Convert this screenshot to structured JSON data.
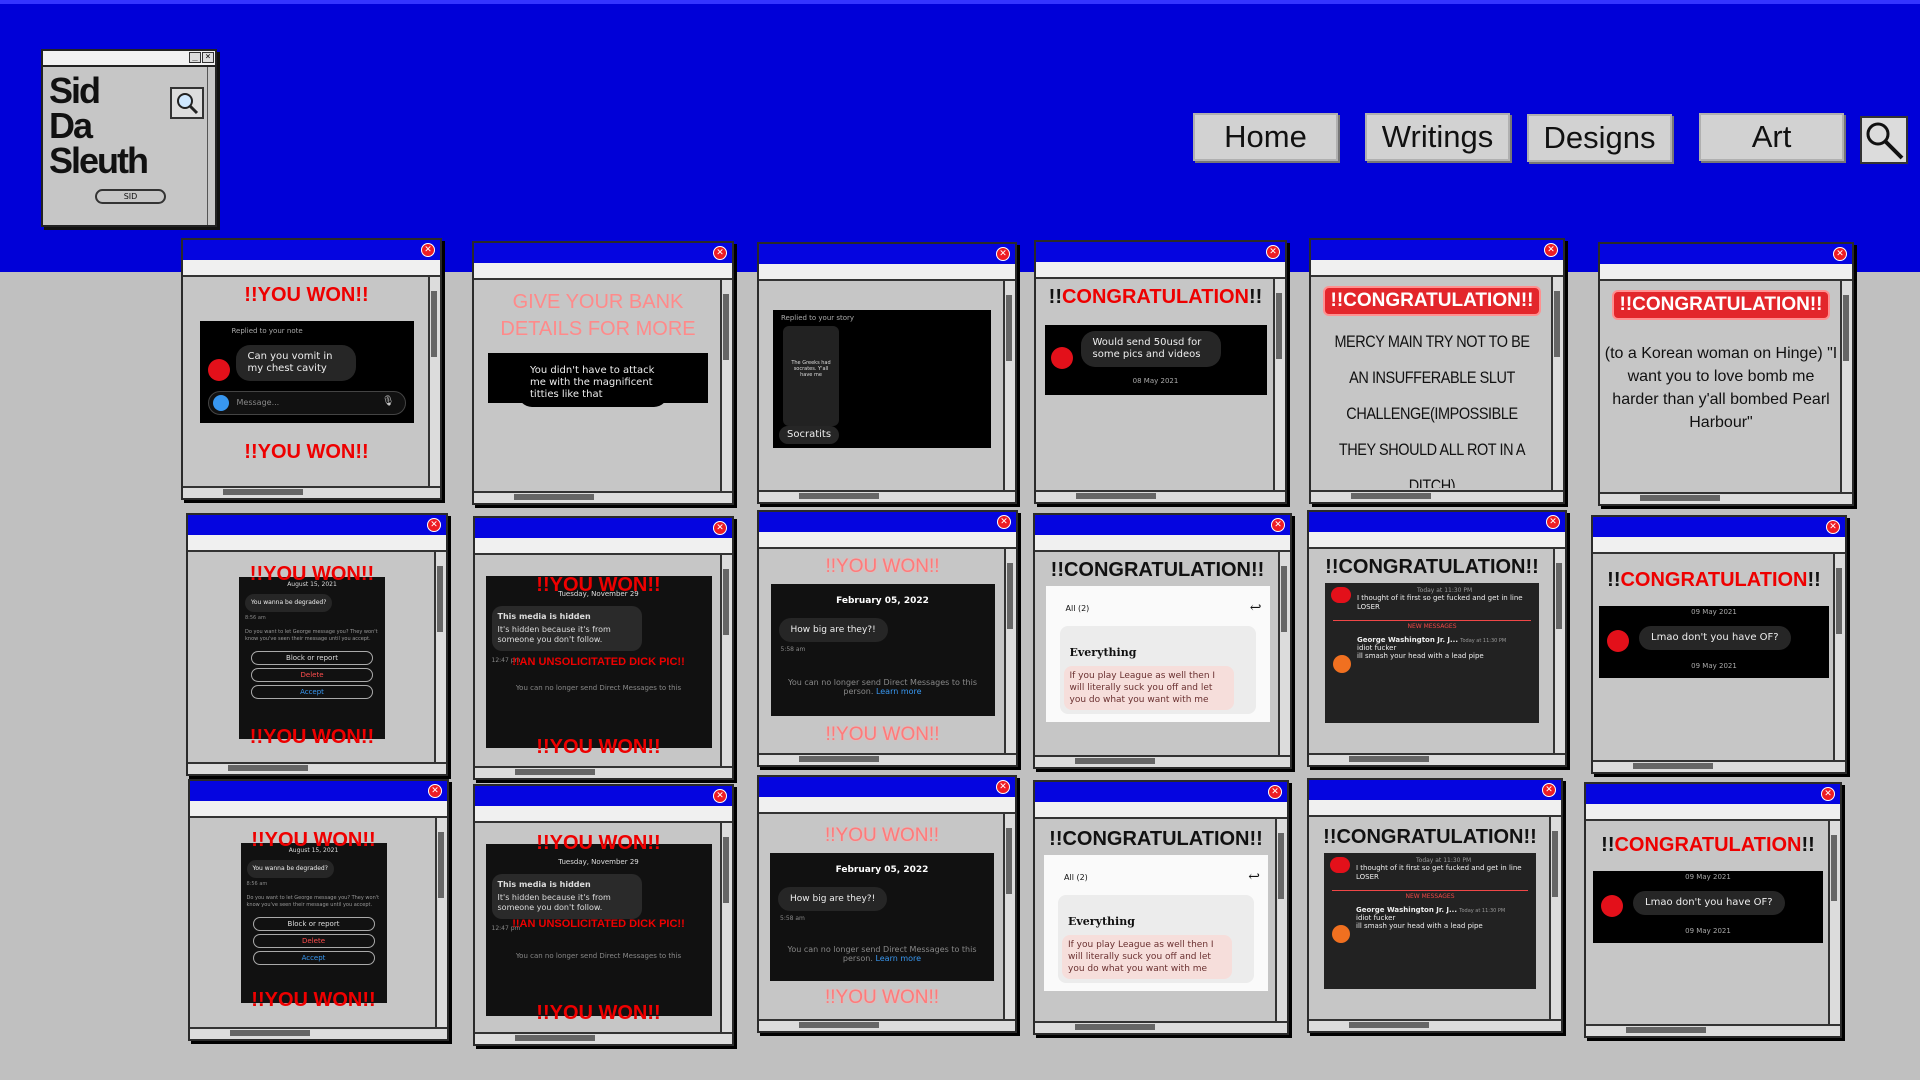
{
  "logo": {
    "line1": "Sid",
    "line2": "Da",
    "line3": "Sleuth",
    "pill": "SID"
  },
  "nav": {
    "home": "Home",
    "writings": "Writings",
    "designs": "Designs",
    "art": "Art"
  },
  "windows": {
    "w1": {
      "title": "!!YOU WON!!",
      "footer": "!!YOU WON!!",
      "reply_label": "Replied to your note",
      "message": "Can you vomit in my chest cavity",
      "input_placeholder": "Message..."
    },
    "w2": {
      "heading": "GIVE YOUR BANK DETAILS FOR MORE",
      "message": "You didn't have to attack me with the magnificent titties like that"
    },
    "w3": {
      "reply_label": "Replied to your story",
      "story_text": "The Greeks had socrates. Y'all have me",
      "name": "Socratits"
    },
    "w4": {
      "title": "!!CONGRATULATION!!",
      "message": "Would send 50usd for some pics and videos",
      "date": "08 May 2021"
    },
    "w5": {
      "title": "!!CONGRATULATION!!",
      "body": "MERCY MAIN TRY NOT TO BE AN INSUFFERABLE SLUT CHALLENGE(IMPOSSIBLE THEY SHOULD ALL ROT IN A DITCH)"
    },
    "w6": {
      "title": "!!CONGRATULATION!!",
      "body": "(to a Korean woman on Hinge) \"I want you to love bomb me harder than y'all bombed Pearl Harbour\""
    },
    "w7": {
      "title": "!!YOU WON!!",
      "footer": "!!YOU WON!!",
      "date": "August 15, 2021",
      "msg": "You wanna be degraded?",
      "time": "8:56 am",
      "prompt": "Do you want to let George message you? They won't know you've seen their message until you accept.",
      "b1": "Block or report",
      "b2": "Delete",
      "b3": "Accept"
    },
    "w8": {
      "title": "!!YOU WON!!",
      "footer": "!!YOU WON!!",
      "date": "Tuesday, November 29",
      "hidden_title": "This media is hidden",
      "hidden_text": "It's hidden because it's from someone you don't follow.",
      "overlay": "!!AN UNSOLICITATED DICK PIC!!",
      "time": "12:47 pm",
      "note": "You can no longer send Direct Messages to this"
    },
    "w9": {
      "title": "!!YOU WON!!",
      "footer": "!!YOU WON!!",
      "date": "February 05, 2022",
      "msg": "How big are they?!",
      "time": "5:58 am",
      "note": "You can no longer send Direct Messages to this person.",
      "link": "Learn more"
    },
    "w10": {
      "title": "!!CONGRATULATION!!",
      "tab": "All (2)",
      "heading": "Everything",
      "msg": "If you play League as well then I will literally suck you off and let you do what you want with me"
    },
    "w11": {
      "title": "!!CONGRATULATION!!",
      "time1": "Today at 11:30 PM",
      "msg1": "I thought of it first so get fucked and get in line LOSER",
      "sep": "NEW MESSAGES",
      "user": "George Washington Jr. J...",
      "time2": "Today at 11:30 PM",
      "msg2a": "idiot fucker",
      "msg2b": "ill smash your head with a lead pipe"
    },
    "w12": {
      "title": "!!CONGRATULATION!!",
      "date": "09 May 2021",
      "msg": "Lmao don't you have OF?",
      "date2": "09 May 2021"
    }
  },
  "colors": {
    "band": "#0000d8",
    "title_bar": "#0505e0",
    "close": "#ee1c24",
    "desktop": "#c0c0c0"
  }
}
